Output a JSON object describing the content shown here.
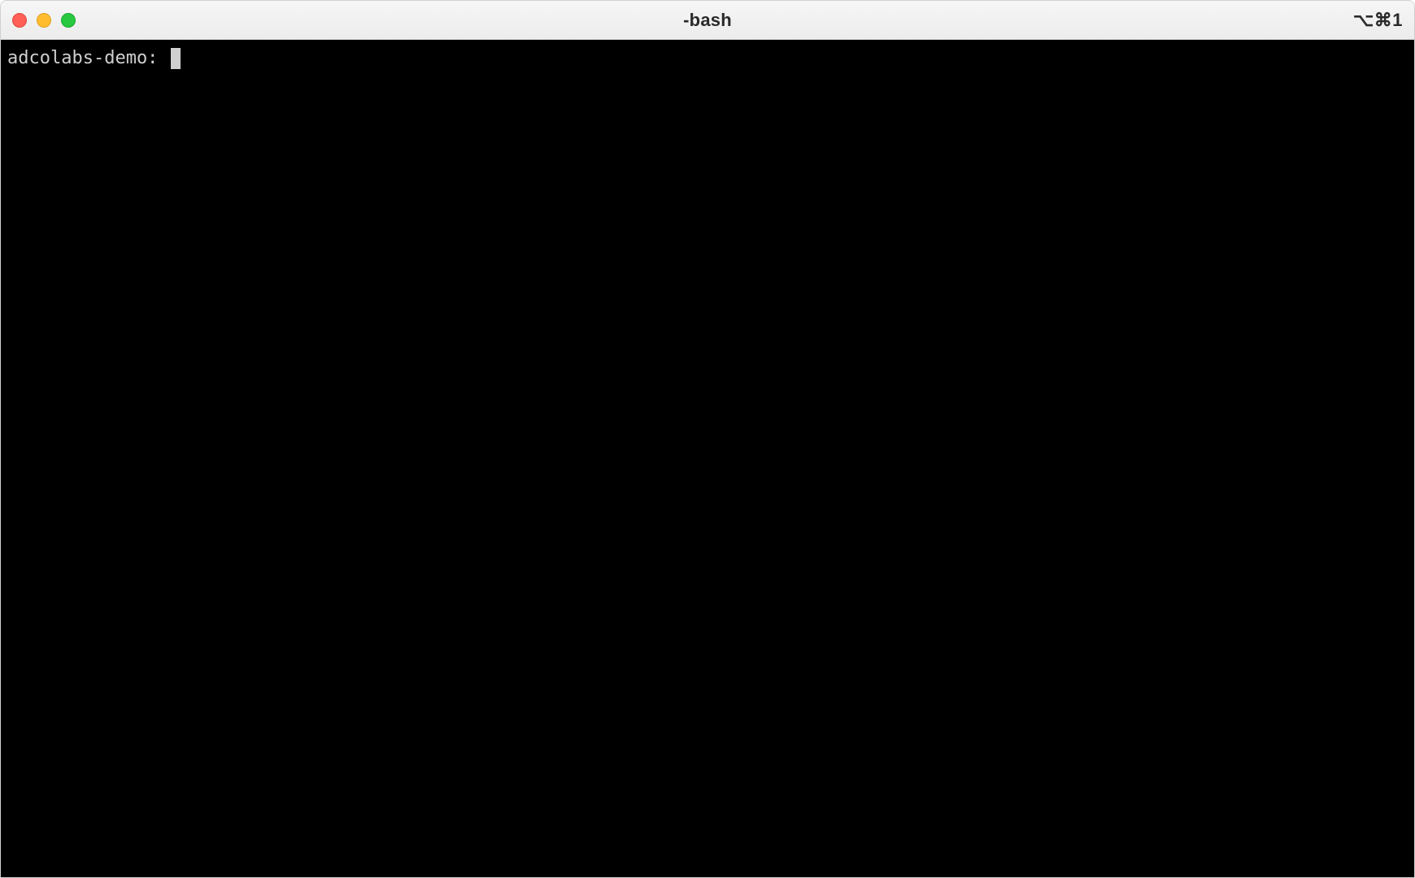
{
  "window": {
    "title": "-bash",
    "shortcut": "⌥⌘1"
  },
  "terminal": {
    "prompt": "adcolabs-demo: ",
    "input": ""
  }
}
